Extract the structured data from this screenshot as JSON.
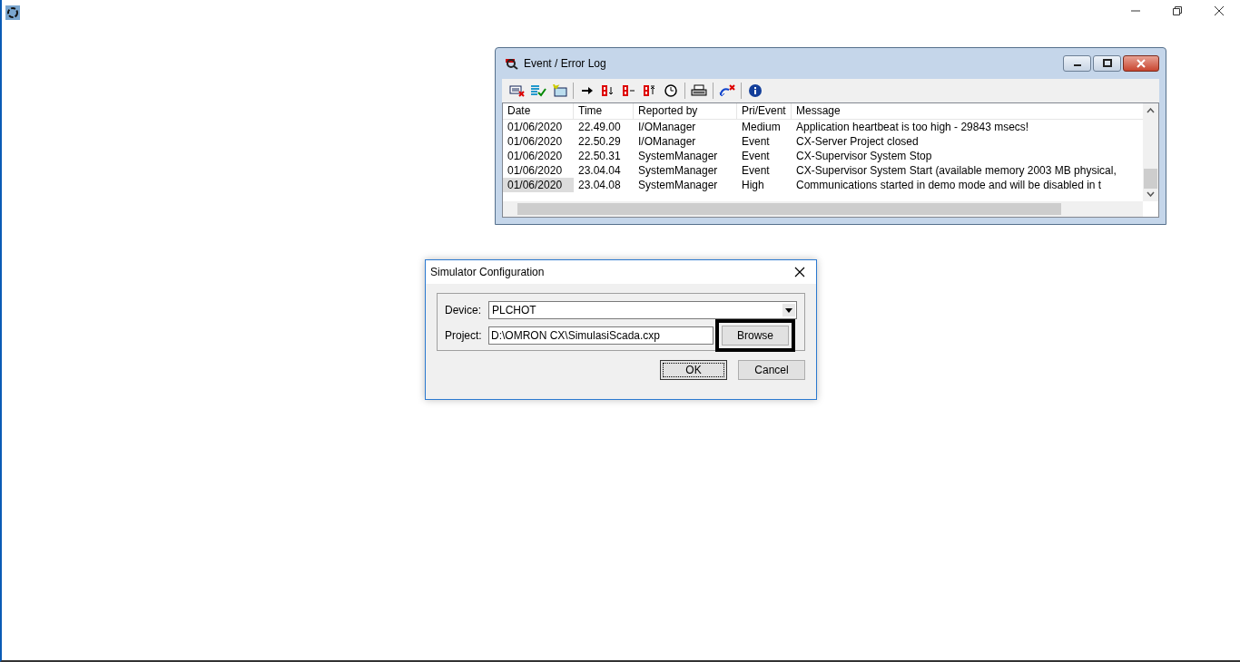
{
  "event_log": {
    "title": "Event / Error Log",
    "toolbar": [
      {
        "kind": "clear"
      },
      {
        "kind": "list-check"
      },
      {
        "kind": "new"
      },
      {
        "kind": "sep"
      },
      {
        "kind": "arrow"
      },
      {
        "kind": "bit-down"
      },
      {
        "kind": "bit-minus"
      },
      {
        "kind": "bit-up"
      },
      {
        "kind": "clock"
      },
      {
        "kind": "sep"
      },
      {
        "kind": "print"
      },
      {
        "kind": "sep"
      },
      {
        "kind": "undo"
      },
      {
        "kind": "sep"
      },
      {
        "kind": "info"
      }
    ],
    "columns": [
      "Date",
      "Time",
      "Reported by",
      "Pri/Event",
      "Message"
    ],
    "rows": [
      {
        "cells": [
          "01/06/2020",
          "22.49.00",
          "I/OManager",
          "Medium",
          "Application heartbeat is too high - 29843 msecs!"
        ],
        "selected": false
      },
      {
        "cells": [
          "01/06/2020",
          "22.50.29",
          "I/OManager",
          "Event",
          "CX-Server Project closed"
        ],
        "selected": false
      },
      {
        "cells": [
          "01/06/2020",
          "22.50.31",
          "SystemManager",
          "Event",
          "CX-Supervisor System Stop"
        ],
        "selected": false
      },
      {
        "cells": [
          "01/06/2020",
          "23.04.04",
          "SystemManager",
          "Event",
          "CX-Supervisor System Start (available memory 2003 MB physical,"
        ],
        "selected": false
      },
      {
        "cells": [
          "01/06/2020",
          "23.04.08",
          "SystemManager",
          "High",
          "Communications started in demo mode and will be disabled in t"
        ],
        "selected": true
      }
    ]
  },
  "dialog": {
    "title": "Simulator Configuration",
    "device": {
      "label": "Device:",
      "value": "PLCHOT"
    },
    "project": {
      "label": "Project:",
      "value": "D:\\OMRON CX\\SimulasiScada.cxp"
    },
    "browse_button": {
      "label": "Browse",
      "highlighted": true
    },
    "buttons": [
      {
        "label": "OK",
        "focused": true
      },
      {
        "label": "Cancel",
        "focused": false
      }
    ]
  }
}
